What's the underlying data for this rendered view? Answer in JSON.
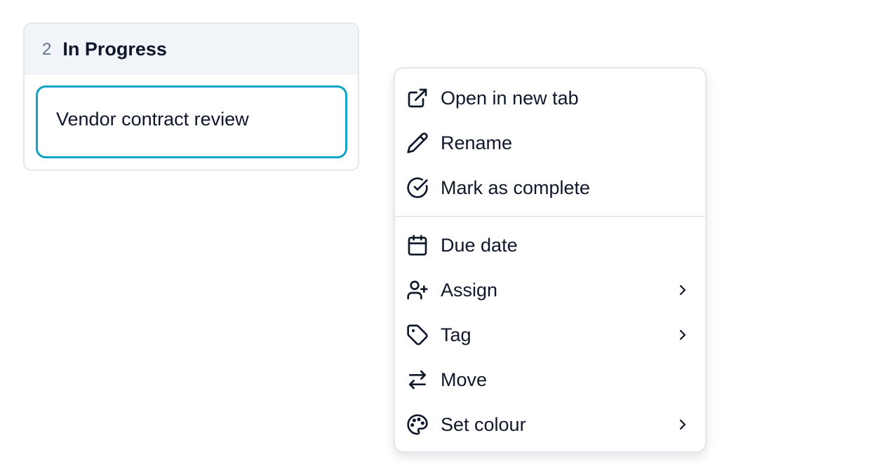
{
  "column": {
    "count": "2",
    "title": "In Progress",
    "card": {
      "title": "Vendor contract review"
    }
  },
  "menu": {
    "items": [
      {
        "label": "Open in new tab",
        "icon": "external-link-icon"
      },
      {
        "label": "Rename",
        "icon": "pencil-icon"
      },
      {
        "label": "Mark as complete",
        "icon": "check-circle-icon"
      },
      {
        "label": "Due date",
        "icon": "calendar-icon"
      },
      {
        "label": "Assign",
        "icon": "user-plus-icon",
        "submenu": true
      },
      {
        "label": "Tag",
        "icon": "tag-icon",
        "submenu": true
      },
      {
        "label": "Move",
        "icon": "arrows-swap-icon"
      },
      {
        "label": "Set colour",
        "icon": "palette-icon",
        "submenu": true
      }
    ]
  },
  "colors": {
    "accent": "#0ea5c8",
    "header_bg": "#f1f5f9",
    "border": "#e5e7eb",
    "text": "#0f172a",
    "muted": "#64748b"
  }
}
